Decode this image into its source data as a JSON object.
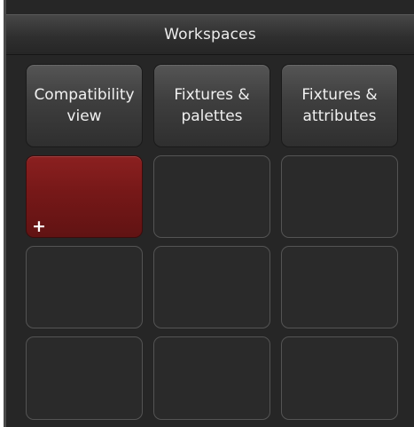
{
  "header": {
    "title": "Workspaces"
  },
  "grid": {
    "buttons": [
      {
        "label": "Compatibility view",
        "state": "default"
      },
      {
        "label": "Fixtures & palettes",
        "state": "default"
      },
      {
        "label": "Fixtures & attributes",
        "state": "default"
      },
      {
        "label": "",
        "state": "selected",
        "icon": "plus-icon",
        "icon_glyph": "+"
      },
      {
        "label": "",
        "state": "empty"
      },
      {
        "label": "",
        "state": "empty"
      },
      {
        "label": "",
        "state": "empty"
      },
      {
        "label": "",
        "state": "empty"
      },
      {
        "label": "",
        "state": "empty"
      },
      {
        "label": "",
        "state": "empty"
      },
      {
        "label": "",
        "state": "empty"
      },
      {
        "label": "",
        "state": "empty"
      }
    ]
  },
  "colors": {
    "panel_background": "#262626",
    "selected_button": "#761818",
    "text": "#f0f0f0"
  }
}
